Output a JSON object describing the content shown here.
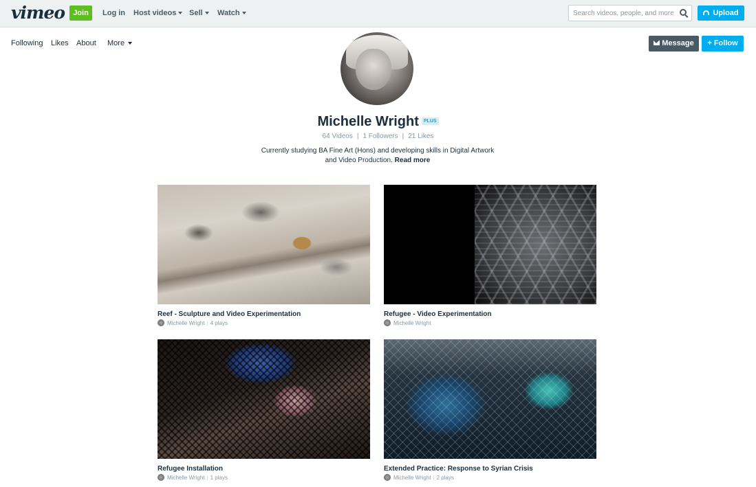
{
  "topbar": {
    "logo": "vimeo",
    "join_label": "Join",
    "nav": [
      {
        "label": "Log in",
        "has_caret": false
      },
      {
        "label": "Host videos",
        "has_caret": true
      },
      {
        "label": "Sell",
        "has_caret": true
      },
      {
        "label": "Watch",
        "has_caret": true
      }
    ],
    "search_placeholder": "Search videos, people, and more",
    "upload_label": "Upload"
  },
  "subnav": {
    "items": [
      "Following",
      "Likes",
      "About",
      "More"
    ],
    "message_label": "Message",
    "follow_label": "+ Follow"
  },
  "profile": {
    "name": "Michelle Wright",
    "badge": "PLUS",
    "stats": {
      "videos": "64 Videos",
      "followers": "1 Followers",
      "likes": "21 Likes"
    },
    "bio": "Currently studying BA Fine Art (Hons) and developing skills in Digital Artwork and Video Production.",
    "read_more": "Read more"
  },
  "videos": [
    {
      "title": "Reef - Sculpture and Video Experimentation",
      "author": "Michelle Wright",
      "plays": "4 plays"
    },
    {
      "title": "Refugee - Video Experimentation",
      "author": "Michelle Wright",
      "plays": ""
    },
    {
      "title": "Refugee Installation",
      "author": "Michelle Wright",
      "plays": "1 plays"
    },
    {
      "title": "Extended Practice: Response to Syrian Crisis",
      "author": "Michelle Wright",
      "plays": "2 plays"
    }
  ],
  "colors": {
    "join": "#5ebd1f",
    "accent": "#00adef",
    "message": "#4a5a64",
    "text": "#1a2e3b",
    "muted": "#8a979e"
  }
}
